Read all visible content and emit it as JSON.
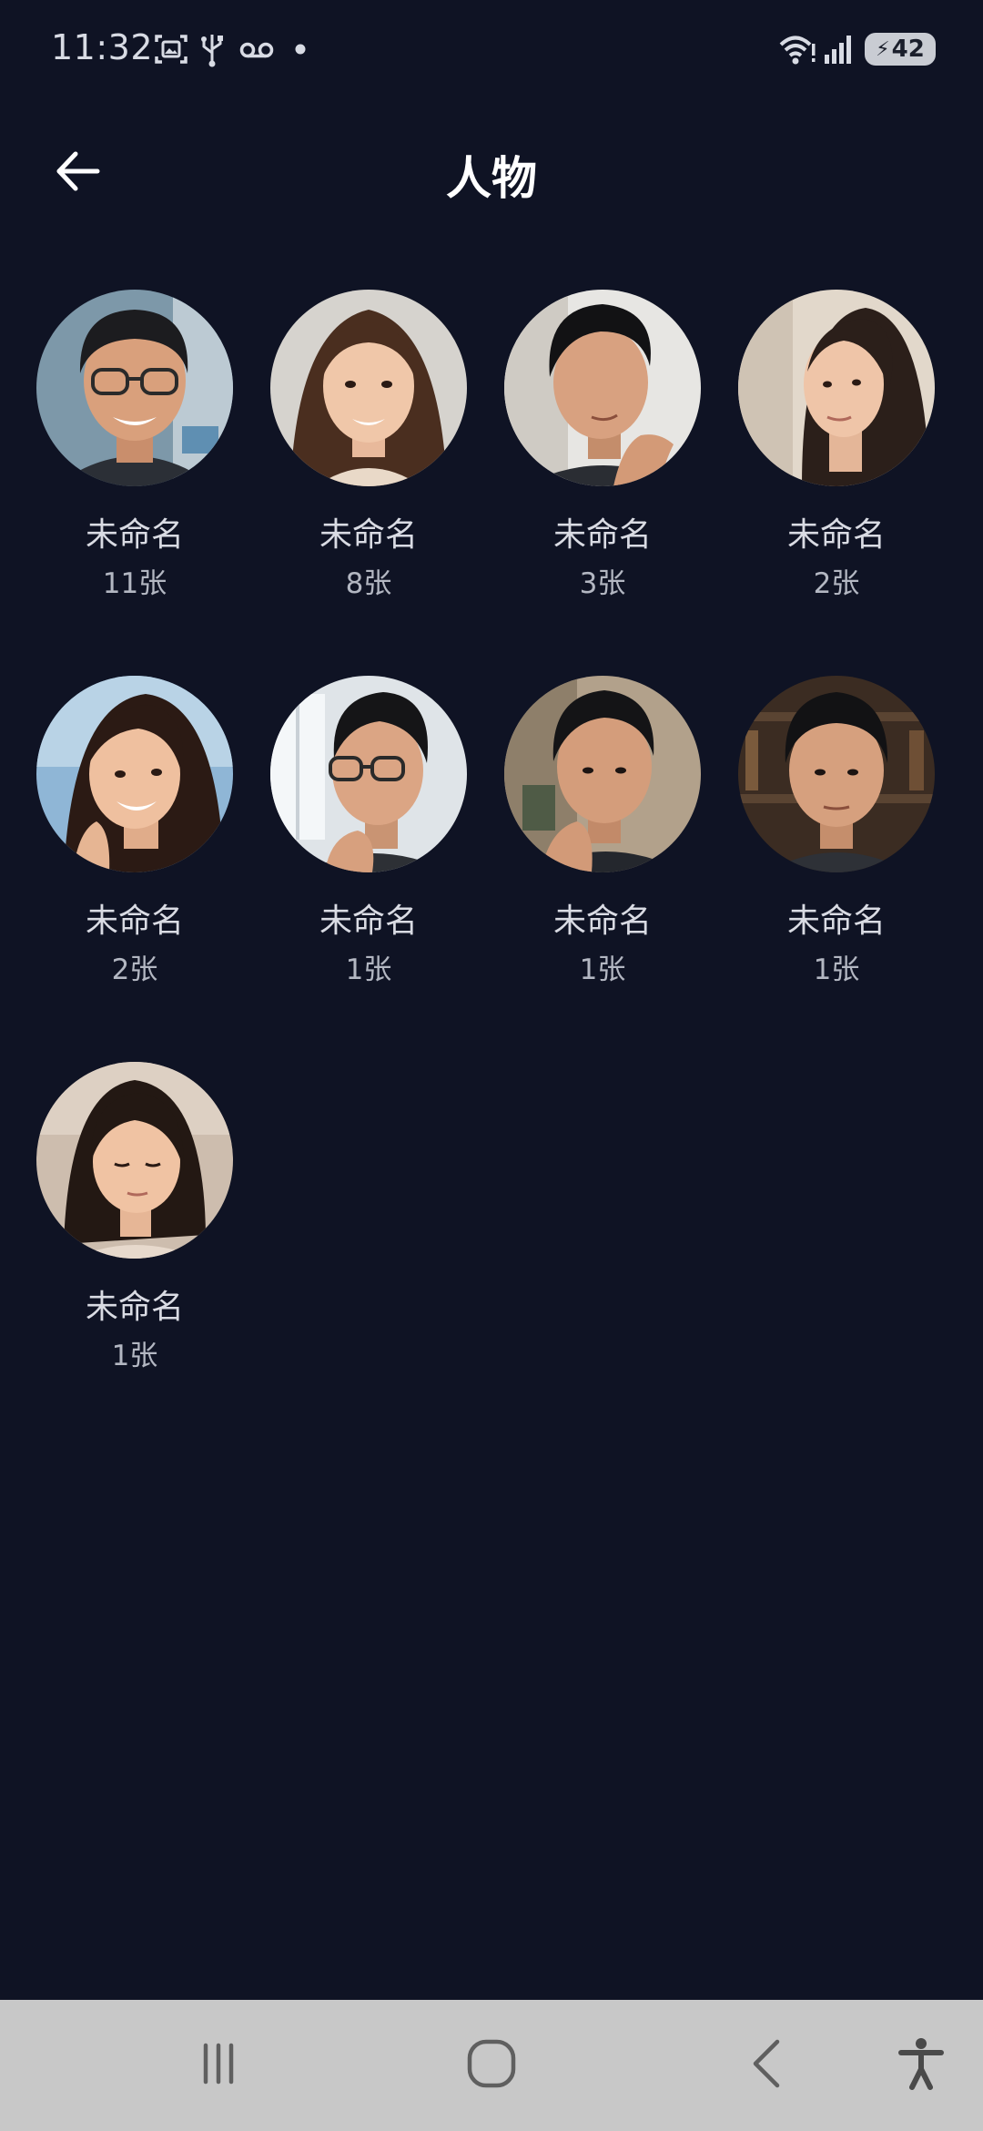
{
  "status_bar": {
    "time": "11:32",
    "battery_level": "42",
    "icons": [
      "screenshot-icon",
      "usb-icon",
      "voicemail-icon",
      "notification-dot-icon",
      "wifi-icon",
      "signal-icon",
      "battery-charging-icon"
    ]
  },
  "header": {
    "title": "人物",
    "back_icon": "arrow-left-icon"
  },
  "people": [
    {
      "name": "未命名",
      "count": "11张"
    },
    {
      "name": "未命名",
      "count": "8张"
    },
    {
      "name": "未命名",
      "count": "3张"
    },
    {
      "name": "未命名",
      "count": "2张"
    },
    {
      "name": "未命名",
      "count": "2张"
    },
    {
      "name": "未命名",
      "count": "1张"
    },
    {
      "name": "未命名",
      "count": "1张"
    },
    {
      "name": "未命名",
      "count": "1张"
    },
    {
      "name": "未命名",
      "count": "1张"
    }
  ],
  "nav_bar": {
    "buttons": [
      "recent-apps-icon",
      "home-icon",
      "back-icon",
      "accessibility-icon"
    ]
  },
  "colors": {
    "background": "#0f1324",
    "nav_background": "#c8c8c8",
    "name_text": "#d9dbe3",
    "count_text": "#b3b7c2"
  }
}
